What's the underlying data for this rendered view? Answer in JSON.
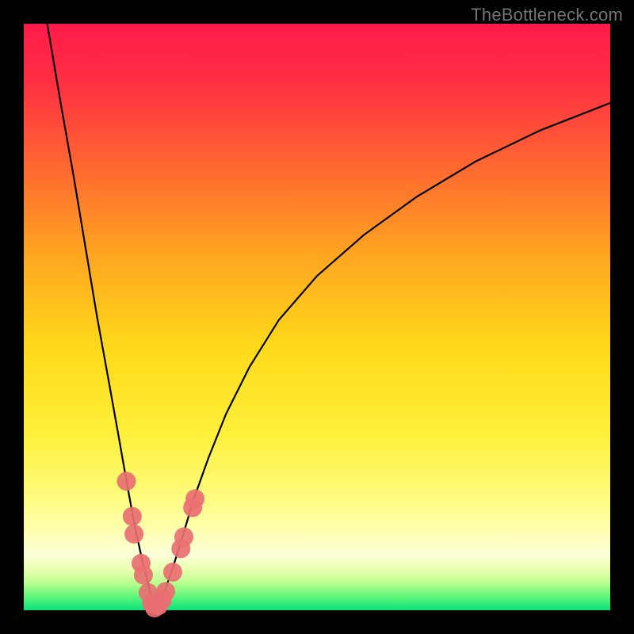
{
  "watermark": "TheBottleneck.com",
  "plot": {
    "margin_left": 30,
    "margin_top": 30,
    "inner_width": 740,
    "inner_height": 740
  },
  "gradient_stops": [
    {
      "offset": 0.0,
      "color": "#ff1a4a"
    },
    {
      "offset": 0.1,
      "color": "#ff2f42"
    },
    {
      "offset": 0.25,
      "color": "#ff6a30"
    },
    {
      "offset": 0.4,
      "color": "#ffa820"
    },
    {
      "offset": 0.55,
      "color": "#ffd91a"
    },
    {
      "offset": 0.7,
      "color": "#fff03a"
    },
    {
      "offset": 0.8,
      "color": "#fffb7a"
    },
    {
      "offset": 0.86,
      "color": "#ffffac"
    },
    {
      "offset": 0.905,
      "color": "#fcffd8"
    },
    {
      "offset": 0.93,
      "color": "#e9ffb0"
    },
    {
      "offset": 0.955,
      "color": "#b6ff8c"
    },
    {
      "offset": 0.978,
      "color": "#5cf57a"
    },
    {
      "offset": 1.0,
      "color": "#07e37a"
    }
  ],
  "chart_data": {
    "type": "line",
    "title": "",
    "xlabel": "",
    "ylabel": "",
    "xlim": [
      0,
      100
    ],
    "ylim": [
      0,
      100
    ],
    "grid": false,
    "note": "V-shaped bottleneck curve. Minimum near x≈22, y≈0. Left arm rises to ~100 at x≈4; right arm rises toward ~86 at x=100.",
    "series": [
      {
        "name": "left-arm",
        "x": [
          4.0,
          6.2,
          8.5,
          10.5,
          12.5,
          14.5,
          16.2,
          17.7,
          19.0,
          20.2,
          21.2,
          21.8,
          22.2,
          22.3
        ],
        "y": [
          100.0,
          87.0,
          74.0,
          62.0,
          50.0,
          39.0,
          29.5,
          21.0,
          14.0,
          8.5,
          4.5,
          2.0,
          0.6,
          0.2
        ]
      },
      {
        "name": "right-arm",
        "x": [
          22.3,
          23.0,
          24.0,
          25.5,
          27.2,
          29.0,
          31.5,
          34.5,
          38.5,
          43.5,
          50.0,
          58.0,
          67.0,
          77.0,
          88.0,
          100.0
        ],
        "y": [
          0.2,
          1.0,
          3.2,
          7.5,
          13.0,
          19.0,
          26.0,
          33.5,
          41.5,
          49.5,
          57.0,
          64.0,
          70.5,
          76.5,
          81.8,
          86.5
        ]
      }
    ],
    "markers": {
      "name": "sample-dots",
      "color": "#e96f72",
      "r": 12,
      "points": [
        {
          "x": 17.5,
          "y": 22.0
        },
        {
          "x": 18.5,
          "y": 16.0
        },
        {
          "x": 18.8,
          "y": 13.0
        },
        {
          "x": 20.0,
          "y": 8.0
        },
        {
          "x": 20.4,
          "y": 6.0
        },
        {
          "x": 21.2,
          "y": 3.0
        },
        {
          "x": 21.8,
          "y": 1.2
        },
        {
          "x": 22.3,
          "y": 0.4
        },
        {
          "x": 23.0,
          "y": 0.8
        },
        {
          "x": 23.6,
          "y": 1.8
        },
        {
          "x": 24.2,
          "y": 3.2
        },
        {
          "x": 25.4,
          "y": 6.5
        },
        {
          "x": 26.8,
          "y": 10.5
        },
        {
          "x": 27.3,
          "y": 12.5
        },
        {
          "x": 28.8,
          "y": 17.5
        },
        {
          "x": 29.2,
          "y": 19.0
        }
      ]
    }
  }
}
